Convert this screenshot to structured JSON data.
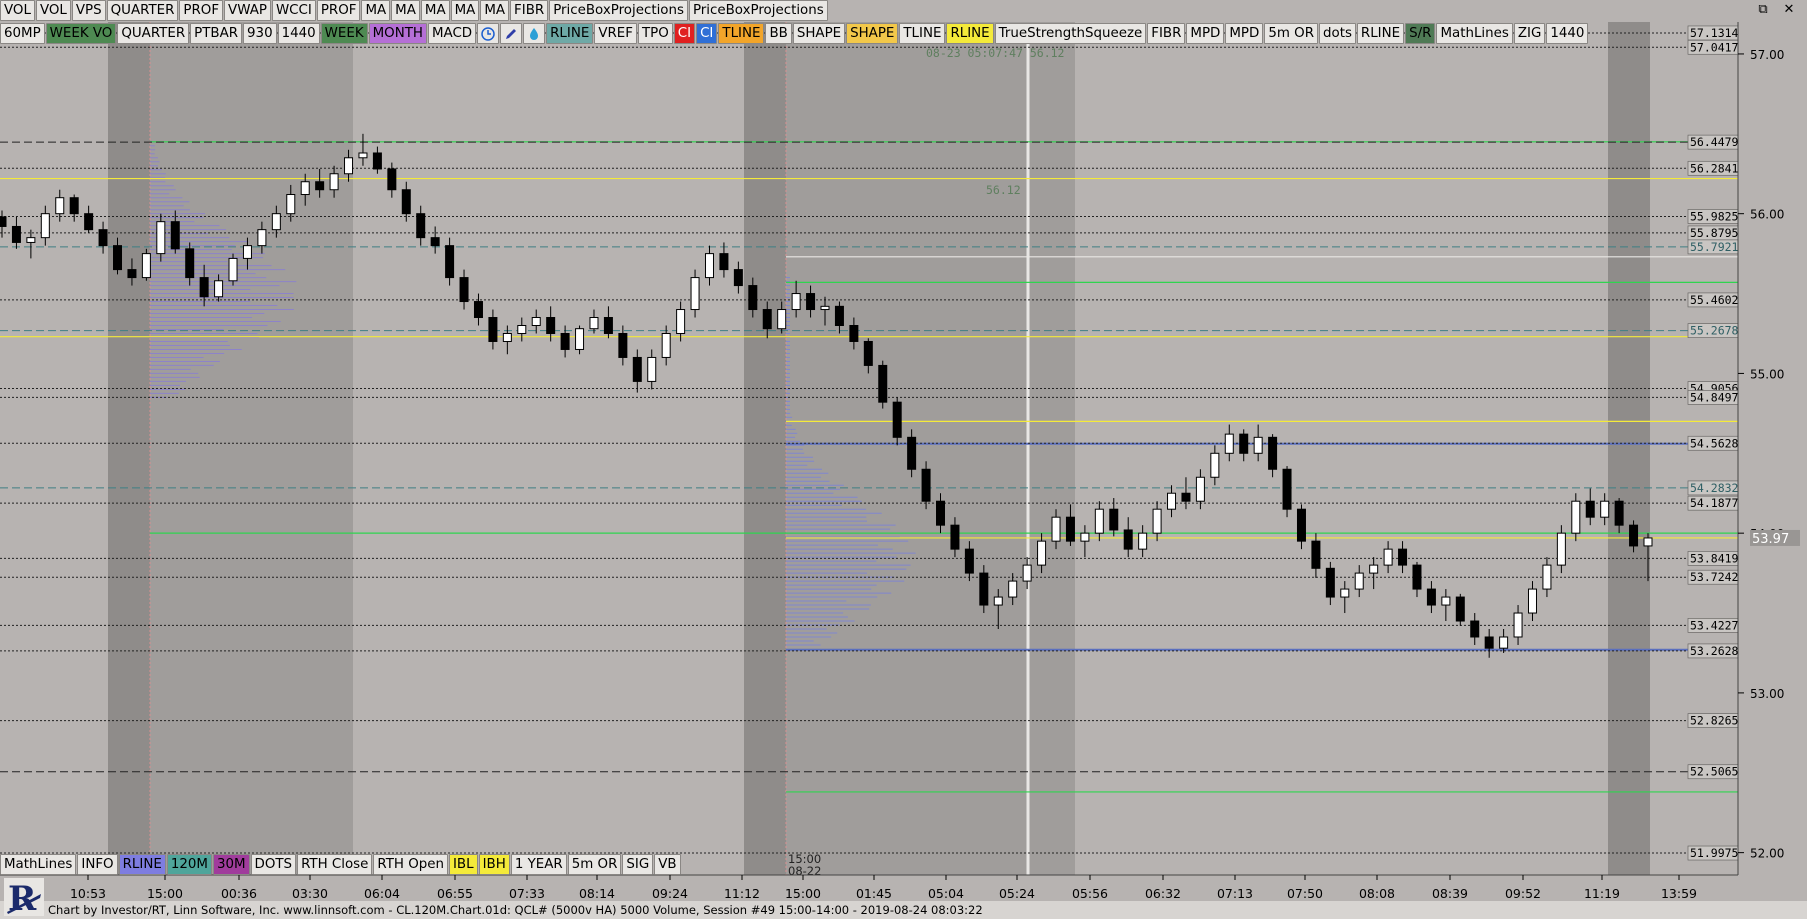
{
  "toolbar_row1": [
    "VOL",
    "VOL",
    "VPS",
    "QUARTER",
    "PROF",
    "VWAP",
    "WCCI",
    "PROF",
    "MA",
    "MA",
    "MA",
    "MA",
    "MA",
    "FIBR",
    "PriceBoxProjections",
    "PriceBoxProjections"
  ],
  "toolbar_row2": [
    {
      "label": "60MP",
      "bg": "#e9e7e4"
    },
    {
      "label": "WEEK VO",
      "bg": "#4e8a52"
    },
    {
      "label": "QUARTER",
      "bg": "#e9e7e4"
    },
    {
      "label": "PTBAR",
      "bg": "#e9e7e4"
    },
    {
      "label": "930",
      "bg": "#e9e7e4"
    },
    {
      "label": "1440",
      "bg": "#e9e7e4"
    },
    {
      "label": "WEEK",
      "bg": "#4e8a52"
    },
    {
      "label": "MONTH",
      "bg": "#b56fd6"
    },
    {
      "label": "MACD",
      "bg": "#e9e7e4"
    },
    {
      "icon": "clock-icon"
    },
    {
      "icon": "pencil-icon"
    },
    {
      "icon": "drop-icon"
    },
    {
      "label": "RLINE",
      "bg": "#6ea9a6"
    },
    {
      "label": "VREF",
      "bg": "#e9e7e4"
    },
    {
      "label": "TPO",
      "bg": "#e9e7e4"
    },
    {
      "label": "CI",
      "bg": "#e02020",
      "fg": "#ffffff"
    },
    {
      "label": "CI",
      "bg": "#2f6fd6",
      "fg": "#ffffff"
    },
    {
      "label": "TLINE",
      "bg": "#f2a52a"
    },
    {
      "label": "BB",
      "bg": "#e9e7e4"
    },
    {
      "label": "SHAPE",
      "bg": "#e9e7e4"
    },
    {
      "label": "SHAPE",
      "bg": "#f2c84a"
    },
    {
      "label": "TLINE",
      "bg": "#e9e7e4"
    },
    {
      "label": "RLINE",
      "bg": "#f4ea3a"
    },
    {
      "label": "TrueStrengthSqueeze",
      "bg": "#e9e7e4"
    },
    {
      "label": "FIBR",
      "bg": "#e9e7e4"
    },
    {
      "label": "MPD",
      "bg": "#e9e7e4"
    },
    {
      "label": "MPD",
      "bg": "#e9e7e4"
    },
    {
      "label": "5m OR",
      "bg": "#e9e7e4"
    },
    {
      "label": "dots",
      "bg": "#e9e7e4"
    },
    {
      "label": "RLINE",
      "bg": "#e9e7e4"
    },
    {
      "label": "S/R",
      "bg": "#4f7a55"
    },
    {
      "label": "MathLines",
      "bg": "#e9e7e4"
    },
    {
      "label": "ZIG",
      "bg": "#e9e7e4"
    },
    {
      "label": "1440",
      "bg": "#e9e7e4"
    }
  ],
  "toolbar_bottom": [
    {
      "label": "MathLines",
      "bg": "#e9e7e4"
    },
    {
      "label": "INFO",
      "bg": "#e9e7e4"
    },
    {
      "label": "RLINE",
      "bg": "#7e7de0"
    },
    {
      "label": "120M",
      "bg": "#4fa59b"
    },
    {
      "label": "30M",
      "bg": "#a03c9c"
    },
    {
      "label": "DOTS",
      "bg": "#e9e7e4"
    },
    {
      "label": "RTH Close",
      "bg": "#e9e7e4"
    },
    {
      "label": "RTH Open",
      "bg": "#e9e7e4"
    },
    {
      "label": "IBL",
      "bg": "#f4ea3a"
    },
    {
      "label": "IBH",
      "bg": "#f4ea3a"
    },
    {
      "label": "1 YEAR",
      "bg": "#e9e7e4"
    },
    {
      "label": "5m OR",
      "bg": "#e9e7e4"
    },
    {
      "label": "SIG",
      "bg": "#e9e7e4"
    },
    {
      "label": "VB",
      "bg": "#e9e7e4"
    }
  ],
  "window_controls": {
    "restore": "⧉",
    "close": "✕"
  },
  "footer": "Chart by Investor/RT, Linn Software, Inc. www.linnsoft.com - CL.120M.Chart.01d: QCL# (5000v HA) 5000 Volume, Session #49 15:00-14:00 - 2019-08-24 08:03:22",
  "logo_letter": "R",
  "chart_data": {
    "type": "candlestick",
    "symbol": "CL",
    "ylim": [
      51.86,
      57.2
    ],
    "y_ticks": [
      52.0,
      53.0,
      54.0,
      55.0,
      56.0,
      57.0
    ],
    "y_tick_labels": [
      "52.00",
      "53.00",
      "54.00",
      "55.00",
      "56.00",
      "57.00"
    ],
    "last_price": 53.97,
    "last_price_label": "53.97",
    "x_tick_labels": [
      "10:53",
      "15:00",
      "00:36",
      "03:30",
      "06:04",
      "06:55",
      "07:33",
      "08:14",
      "09:24",
      "11:12",
      "15:00",
      "01:45",
      "05:04",
      "05:24",
      "05:56",
      "06:32",
      "07:13",
      "07:50",
      "08:08",
      "08:39",
      "09:52",
      "11:19",
      "13:59"
    ],
    "session_break_label": {
      "time": "15:00",
      "date": "08-22"
    },
    "top_annotation": "08-23 05:07:47 56.12",
    "mid_annotation": "56.12",
    "price_levels": [
      {
        "value": 57.1314,
        "label": "57.1314",
        "color": "#222222",
        "dash": "dotted"
      },
      {
        "value": 57.0417,
        "label": "57.0417",
        "color": "#222222",
        "dash": "dotted"
      },
      {
        "value": 56.4479,
        "label": "56.4479",
        "color": "#222222",
        "dash": "dashed"
      },
      {
        "value": 56.2841,
        "label": "56.2841",
        "color": "#222222",
        "dash": "dotted"
      },
      {
        "value": 55.9825,
        "label": "55.9825",
        "color": "#222222",
        "dash": "dotted"
      },
      {
        "value": 55.8795,
        "label": "55.8795",
        "color": "#222222",
        "dash": "dotted"
      },
      {
        "value": 55.7921,
        "label": "55.7921",
        "color": "#3f7f84",
        "dash": "dashed"
      },
      {
        "value": 55.4602,
        "label": "55.4602",
        "color": "#222222",
        "dash": "dotted"
      },
      {
        "value": 55.2678,
        "label": "55.2678",
        "color": "#3f7f84",
        "dash": "dashed"
      },
      {
        "value": 54.9056,
        "label": "54.9056",
        "color": "#222222",
        "dash": "dotted"
      },
      {
        "value": 54.8497,
        "label": "54.8497",
        "color": "#222222",
        "dash": "dotted"
      },
      {
        "value": 54.5628,
        "label": "54.5628",
        "color": "#222222",
        "dash": "dotted"
      },
      {
        "value": 54.2832,
        "label": "54.2832",
        "color": "#3f7f84",
        "dash": "dashed"
      },
      {
        "value": 54.1877,
        "label": "54.1877",
        "color": "#222222",
        "dash": "dotted"
      },
      {
        "value": 53.8419,
        "label": "53.8419",
        "color": "#222222",
        "dash": "dotted"
      },
      {
        "value": 53.7242,
        "label": "53.7242",
        "color": "#222222",
        "dash": "dotted"
      },
      {
        "value": 53.4227,
        "label": "53.4227",
        "color": "#222222",
        "dash": "dotted"
      },
      {
        "value": 53.2628,
        "label": "53.2628",
        "color": "#222222",
        "dash": "dotted"
      },
      {
        "value": 52.8265,
        "label": "52.8265",
        "color": "#222222",
        "dash": "dotted"
      },
      {
        "value": 52.5065,
        "label": "52.5065",
        "color": "#222222",
        "dash": "dashed"
      },
      {
        "value": 51.9975,
        "label": "51.9975",
        "color": "#222222",
        "dash": "dotted"
      }
    ],
    "extra_lines": [
      {
        "value": 56.22,
        "color": "#f4ea3a"
      },
      {
        "value": 55.73,
        "color": "#e9e7e4"
      },
      {
        "value": 55.23,
        "color": "#f4ea3a"
      },
      {
        "value": 55.57,
        "color": "#2fd44f"
      },
      {
        "value": 54.7,
        "color": "#f4ea3a"
      },
      {
        "value": 53.97,
        "color": "#f4ea3a"
      },
      {
        "value": 54.56,
        "color": "#5a6fbf"
      },
      {
        "value": 53.27,
        "color": "#5a6fbf"
      },
      {
        "value": 56.45,
        "color": "#2fd44f"
      },
      {
        "value": 52.38,
        "color": "#2fd44f"
      },
      {
        "value": 54.0,
        "color": "#2fd44f"
      }
    ],
    "candles": [
      [
        55.98,
        56.02,
        55.85,
        55.92
      ],
      [
        55.92,
        55.98,
        55.78,
        55.82
      ],
      [
        55.82,
        55.9,
        55.72,
        55.85
      ],
      [
        55.85,
        56.05,
        55.8,
        56.0
      ],
      [
        56.0,
        56.15,
        55.95,
        56.1
      ],
      [
        56.1,
        56.12,
        55.95,
        56.0
      ],
      [
        56.0,
        56.05,
        55.88,
        55.9
      ],
      [
        55.9,
        55.95,
        55.75,
        55.8
      ],
      [
        55.8,
        55.85,
        55.62,
        55.65
      ],
      [
        55.65,
        55.72,
        55.55,
        55.6
      ],
      [
        55.6,
        55.78,
        55.58,
        55.75
      ],
      [
        55.75,
        56.0,
        55.7,
        55.95
      ],
      [
        55.95,
        56.02,
        55.75,
        55.78
      ],
      [
        55.78,
        55.82,
        55.55,
        55.6
      ],
      [
        55.6,
        55.68,
        55.42,
        55.48
      ],
      [
        55.48,
        55.62,
        55.45,
        55.58
      ],
      [
        55.58,
        55.75,
        55.55,
        55.72
      ],
      [
        55.72,
        55.85,
        55.65,
        55.8
      ],
      [
        55.8,
        55.95,
        55.75,
        55.9
      ],
      [
        55.9,
        56.05,
        55.85,
        56.0
      ],
      [
        56.0,
        56.18,
        55.95,
        56.12
      ],
      [
        56.12,
        56.25,
        56.05,
        56.2
      ],
      [
        56.2,
        56.28,
        56.1,
        56.15
      ],
      [
        56.15,
        56.3,
        56.1,
        56.25
      ],
      [
        56.25,
        56.4,
        56.2,
        56.35
      ],
      [
        56.35,
        56.5,
        56.3,
        56.38
      ],
      [
        56.38,
        56.42,
        56.25,
        56.28
      ],
      [
        56.28,
        56.32,
        56.1,
        56.15
      ],
      [
        56.15,
        56.2,
        55.95,
        56.0
      ],
      [
        56.0,
        56.05,
        55.8,
        55.85
      ],
      [
        55.85,
        55.92,
        55.75,
        55.8
      ],
      [
        55.8,
        55.85,
        55.55,
        55.6
      ],
      [
        55.6,
        55.65,
        55.4,
        55.45
      ],
      [
        55.45,
        55.5,
        55.3,
        55.35
      ],
      [
        55.35,
        55.4,
        55.15,
        55.2
      ],
      [
        55.2,
        55.3,
        55.12,
        55.25
      ],
      [
        55.25,
        55.35,
        55.2,
        55.3
      ],
      [
        55.3,
        55.4,
        55.25,
        55.35
      ],
      [
        55.35,
        55.42,
        55.2,
        55.25
      ],
      [
        55.25,
        55.3,
        55.1,
        55.15
      ],
      [
        55.15,
        55.3,
        55.12,
        55.28
      ],
      [
        55.28,
        55.4,
        55.25,
        55.35
      ],
      [
        55.35,
        55.42,
        55.22,
        55.25
      ],
      [
        55.25,
        55.3,
        55.05,
        55.1
      ],
      [
        55.1,
        55.15,
        54.88,
        54.95
      ],
      [
        54.95,
        55.15,
        54.9,
        55.1
      ],
      [
        55.1,
        55.3,
        55.05,
        55.25
      ],
      [
        55.25,
        55.45,
        55.2,
        55.4
      ],
      [
        55.4,
        55.65,
        55.35,
        55.6
      ],
      [
        55.6,
        55.8,
        55.55,
        55.75
      ],
      [
        55.75,
        55.82,
        55.6,
        55.65
      ],
      [
        55.65,
        55.7,
        55.5,
        55.55
      ],
      [
        55.55,
        55.6,
        55.35,
        55.4
      ],
      [
        55.4,
        55.45,
        55.22,
        55.28
      ],
      [
        55.28,
        55.45,
        55.25,
        55.4
      ],
      [
        55.4,
        55.58,
        55.35,
        55.5
      ],
      [
        55.5,
        55.55,
        55.35,
        55.4
      ],
      [
        55.4,
        55.48,
        55.3,
        55.42
      ],
      [
        55.42,
        55.45,
        55.25,
        55.3
      ],
      [
        55.3,
        55.35,
        55.15,
        55.2
      ],
      [
        55.2,
        55.22,
        55.0,
        55.05
      ],
      [
        55.05,
        55.08,
        54.78,
        54.82
      ],
      [
        54.82,
        54.85,
        54.55,
        54.6
      ],
      [
        54.6,
        54.65,
        54.35,
        54.4
      ],
      [
        54.4,
        54.45,
        54.15,
        54.2
      ],
      [
        54.2,
        54.25,
        54.0,
        54.05
      ],
      [
        54.05,
        54.1,
        53.85,
        53.9
      ],
      [
        53.9,
        53.95,
        53.7,
        53.75
      ],
      [
        53.75,
        53.8,
        53.5,
        53.55
      ],
      [
        53.55,
        53.65,
        53.4,
        53.6
      ],
      [
        53.6,
        53.75,
        53.55,
        53.7
      ],
      [
        53.7,
        53.85,
        53.65,
        53.8
      ],
      [
        53.8,
        54.0,
        53.75,
        53.95
      ],
      [
        53.95,
        54.15,
        53.9,
        54.1
      ],
      [
        54.1,
        54.18,
        53.92,
        53.95
      ],
      [
        53.95,
        54.05,
        53.85,
        54.0
      ],
      [
        54.0,
        54.2,
        53.95,
        54.15
      ],
      [
        54.15,
        54.22,
        53.98,
        54.02
      ],
      [
        54.02,
        54.1,
        53.85,
        53.9
      ],
      [
        53.9,
        54.05,
        53.85,
        54.0
      ],
      [
        54.0,
        54.2,
        53.95,
        54.15
      ],
      [
        54.15,
        54.3,
        54.1,
        54.25
      ],
      [
        54.25,
        54.35,
        54.15,
        54.2
      ],
      [
        54.2,
        54.4,
        54.15,
        54.35
      ],
      [
        54.35,
        54.55,
        54.3,
        54.5
      ],
      [
        54.5,
        54.68,
        54.45,
        54.62
      ],
      [
        54.62,
        54.65,
        54.45,
        54.5
      ],
      [
        54.5,
        54.68,
        54.45,
        54.6
      ],
      [
        54.6,
        54.62,
        54.35,
        54.4
      ],
      [
        54.4,
        54.42,
        54.1,
        54.15
      ],
      [
        54.15,
        54.18,
        53.9,
        53.95
      ],
      [
        53.95,
        54.0,
        53.72,
        53.78
      ],
      [
        53.78,
        53.82,
        53.55,
        53.6
      ],
      [
        53.6,
        53.7,
        53.5,
        53.65
      ],
      [
        53.65,
        53.8,
        53.6,
        53.75
      ],
      [
        53.75,
        53.85,
        53.65,
        53.8
      ],
      [
        53.8,
        53.95,
        53.75,
        53.9
      ],
      [
        53.9,
        53.95,
        53.75,
        53.8
      ],
      [
        53.8,
        53.82,
        53.6,
        53.65
      ],
      [
        53.65,
        53.7,
        53.5,
        53.55
      ],
      [
        53.55,
        53.65,
        53.45,
        53.6
      ],
      [
        53.6,
        53.62,
        53.42,
        53.45
      ],
      [
        53.45,
        53.5,
        53.3,
        53.35
      ],
      [
        53.35,
        53.4,
        53.22,
        53.28
      ],
      [
        53.28,
        53.4,
        53.25,
        53.35
      ],
      [
        53.35,
        53.55,
        53.3,
        53.5
      ],
      [
        53.5,
        53.7,
        53.45,
        53.65
      ],
      [
        53.65,
        53.85,
        53.6,
        53.8
      ],
      [
        53.8,
        54.05,
        53.75,
        54.0
      ],
      [
        54.0,
        54.25,
        53.95,
        54.2
      ],
      [
        54.2,
        54.28,
        54.05,
        54.1
      ],
      [
        54.1,
        54.25,
        54.05,
        54.2
      ],
      [
        54.2,
        54.22,
        54.0,
        54.05
      ],
      [
        54.05,
        54.08,
        53.88,
        53.92
      ],
      [
        53.92,
        54.0,
        53.7,
        53.97
      ]
    ]
  }
}
